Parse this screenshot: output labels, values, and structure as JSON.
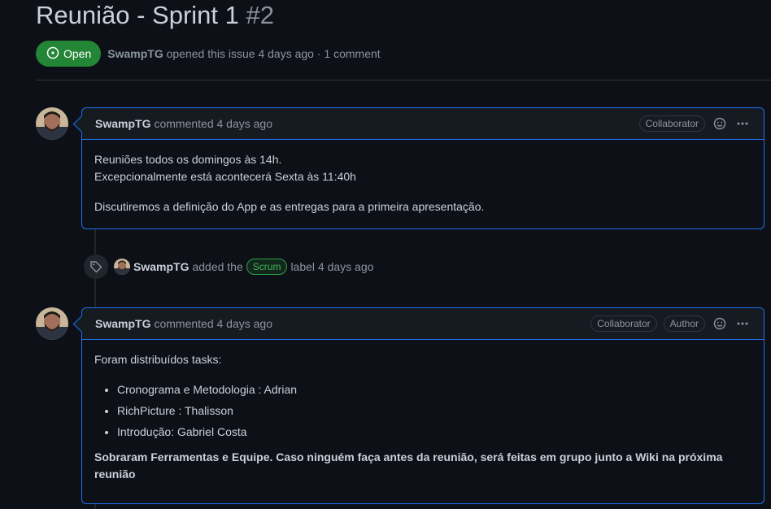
{
  "issue": {
    "title": "Reunião - Sprint 1",
    "number": "#2",
    "state": "Open",
    "author": "SwampTG",
    "opened_text": "opened this issue 4 days ago · 1 comment"
  },
  "comments": [
    {
      "author": "SwampTG",
      "action": "commented 4 days ago",
      "badges": [
        "Collaborator"
      ],
      "body_lines": [
        "Reuniões todos os domingos às 14h.",
        "Excepcionalmente está acontecerá Sexta às 11:40h",
        "Discutiremos a definição do App e as entregas para a primeira apresentação."
      ]
    },
    {
      "author": "SwampTG",
      "action": "commented 4 days ago",
      "badges": [
        "Collaborator",
        "Author"
      ],
      "intro": "Foram distribuídos tasks:",
      "tasks": [
        "Cronograma e Metodologia : Adrian",
        "RichPicture : Thalisson",
        "Introdução: Gabriel Costa"
      ],
      "bold_note": "Sobraram Ferramentas e Equipe. Caso ninguém faça antes da reunião, será feitas em grupo junto a Wiki na próxima reunião"
    }
  ],
  "event": {
    "actor": "SwampTG",
    "text_before": "added the",
    "label": "Scrum",
    "text_after": "label 4 days ago"
  },
  "icons": {
    "state": "issue-opened-icon",
    "emoji": "smiley-icon",
    "menu": "kebab-horizontal-icon",
    "event": "tag-icon"
  },
  "colors": {
    "open_green": "#238636",
    "label_green": "#3fb950",
    "border_blue": "#1f6feb"
  }
}
